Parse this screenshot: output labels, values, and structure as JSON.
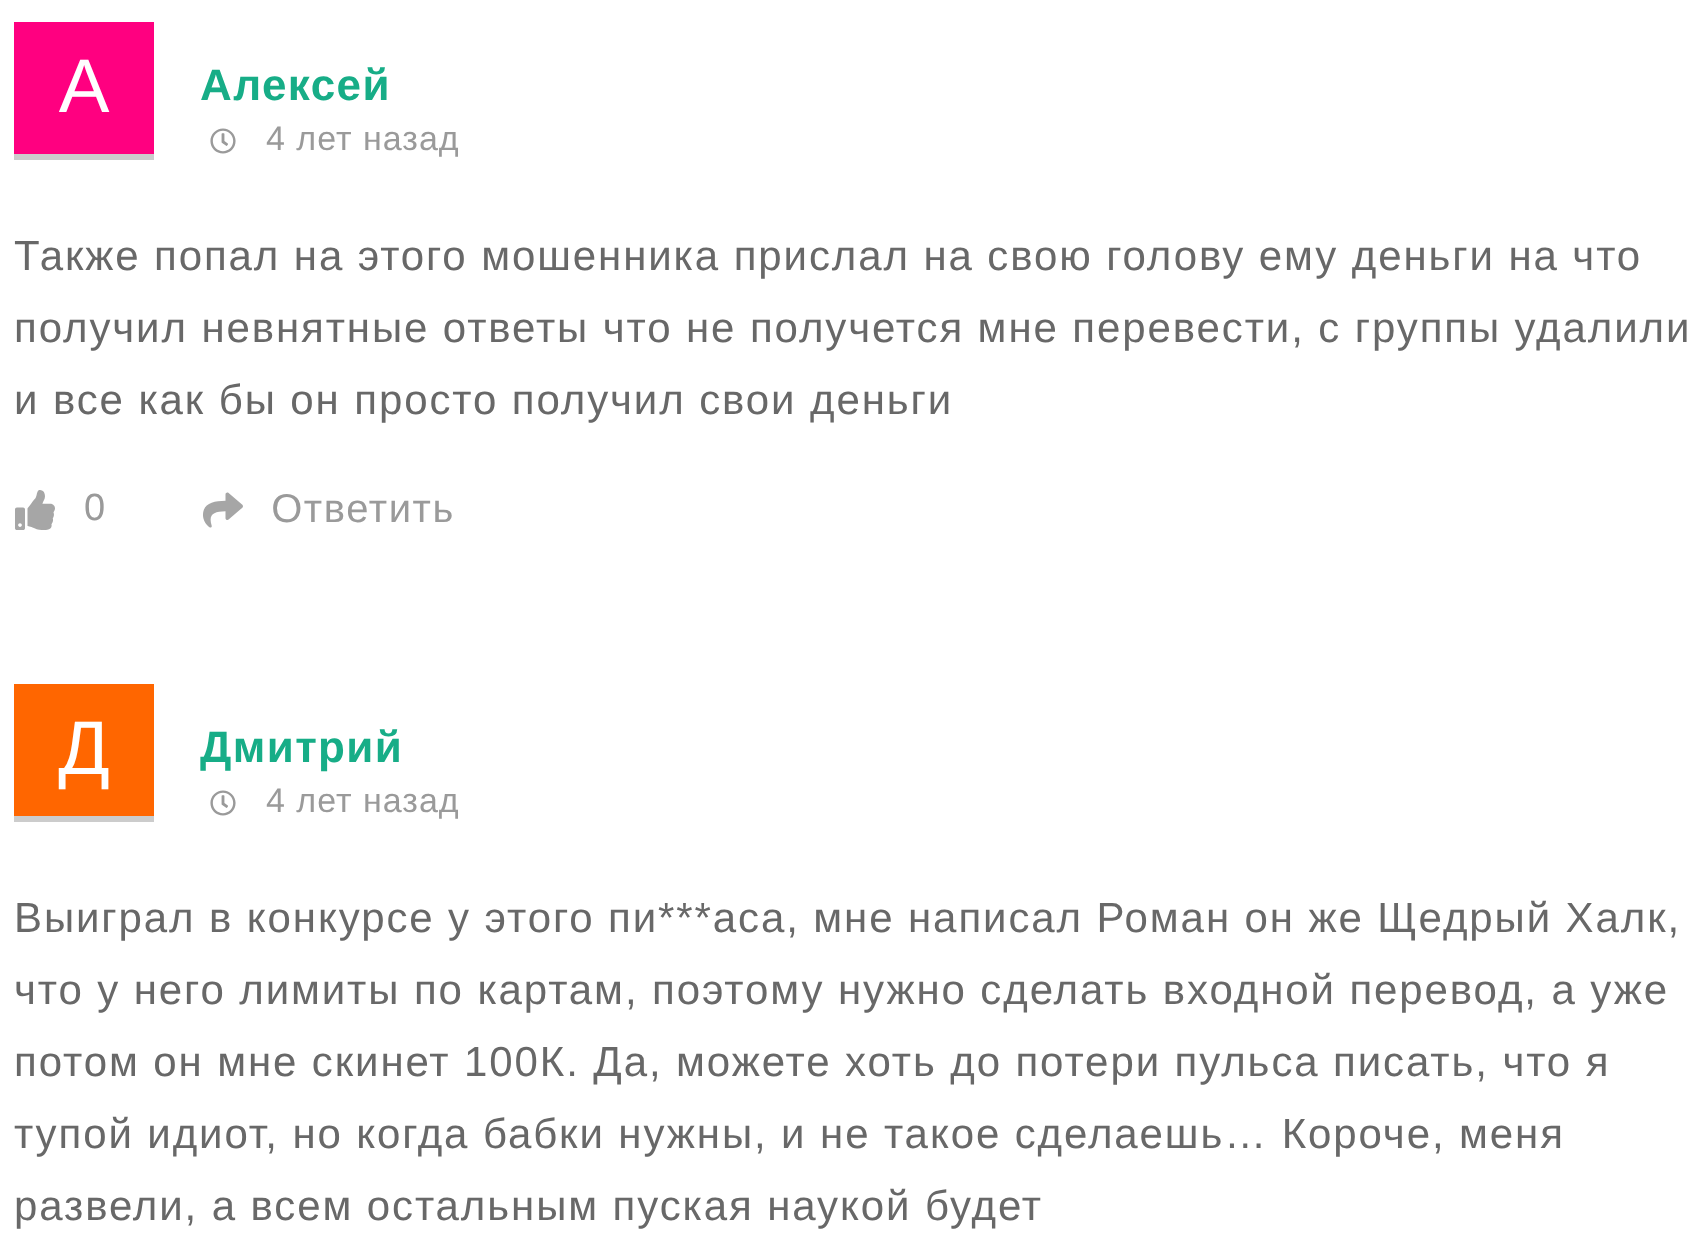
{
  "comments": [
    {
      "avatar": {
        "letter": "А",
        "color": "#ff0080"
      },
      "author": "Алексей",
      "time": "4 лет назад",
      "text": "Также попал на этого мошенника прислал на свою голову ему деньги на что получил невнятные ответы что не получется мне перевести, с группы удалили и все как бы он просто получил свои деньги",
      "likes": "0",
      "reply": "Ответить"
    },
    {
      "avatar": {
        "letter": "Д",
        "color": "#ff6600"
      },
      "author": "Дмитрий",
      "time": "4 лет назад",
      "text": "Выиграл в конкурсе у этого пи***аса, мне написал Роман он же Щедрый Халк, что у него лимиты по картам, поэтому нужно сделать входной перевод, а уже потом он мне скинет 100К. Да, можете хоть до потери пульса писать, что я тупой идиот, но когда бабки нужны, и не такое сделаешь… Короче, меня развели, а всем остальным пуская наукой будет"
    }
  ]
}
